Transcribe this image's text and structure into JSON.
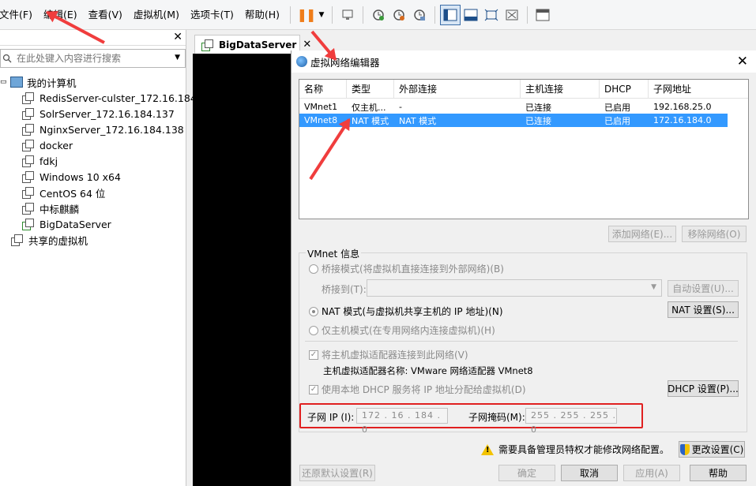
{
  "menu": {
    "items": [
      "文件(F)",
      "编辑(E)",
      "查看(V)",
      "虚拟机(M)",
      "选项卡(T)",
      "帮助(H)"
    ]
  },
  "toolbar": {
    "icons": [
      "pause-icon",
      "dropdown-icon",
      "send-ctrl-alt-del-icon",
      "snapshot-icon",
      "revert-snapshot-icon",
      "snapshot-manager-icon",
      "library-view-icon",
      "console-view-icon",
      "fullscreen-icon",
      "unity-icon",
      "thumbnail-icon"
    ]
  },
  "library": {
    "search_placeholder": "在此处键入内容进行搜索",
    "root_label": "我的计算机",
    "vms": [
      "RedisServer-culster_172.16.184.",
      "SolrServer_172.16.184.137",
      "NginxServer_172.16.184.138",
      "docker",
      "fdkj",
      "Windows 10 x64",
      "CentOS 64 位",
      "中标麒麟",
      "BigDataServer"
    ],
    "shared_label": "共享的虚拟机"
  },
  "vm_tab": {
    "label": "BigDataServer"
  },
  "dialog": {
    "title": "虚拟网络编辑器",
    "table": {
      "headers": [
        "名称",
        "类型",
        "外部连接",
        "主机连接",
        "DHCP",
        "子网地址"
      ],
      "rows": [
        [
          "VMnet1",
          "仅主机...",
          "-",
          "已连接",
          "已启用",
          "192.168.25.0"
        ],
        [
          "VMnet8",
          "NAT 模式",
          "NAT 模式",
          "已连接",
          "已启用",
          "172.16.184.0"
        ]
      ],
      "selected_row": 1
    },
    "add_network": "添加网络(E)...",
    "remove_network": "移除网络(O)",
    "vmnet_info": "VMnet 信息",
    "bridge_mode": "桥接模式(将虚拟机直接连接到外部网络)(B)",
    "bridge_to": "桥接到(T):",
    "auto_settings": "自动设置(U)...",
    "nat_mode": "NAT 模式(与虚拟机共享主机的 IP 地址)(N)",
    "nat_settings": "NAT 设置(S)...",
    "host_only": "仅主机模式(在专用网络内连接虚拟机)(H)",
    "connect_adapter": "将主机虚拟适配器连接到此网络(V)",
    "adapter_name": "主机虚拟适配器名称: VMware 网络适配器 VMnet8",
    "use_dhcp": "使用本地 DHCP 服务将 IP 地址分配给虚拟机(D)",
    "dhcp_settings": "DHCP 设置(P)...",
    "subnet_ip_label": "子网 IP (I):",
    "subnet_ip": "172 . 16 . 184 . 0",
    "subnet_mask_label": "子网掩码(M):",
    "subnet_mask": "255 . 255 . 255 . 0",
    "admin_warning": "需要具备管理员特权才能修改网络配置。",
    "change_settings": "更改设置(C)",
    "restore_defaults": "还原默认设置(R)",
    "ok": "确定",
    "cancel": "取消",
    "apply": "应用(A)",
    "help": "帮助"
  },
  "colors": {
    "selection": "#3399ff",
    "annotation": "#f03d3d",
    "pause": "#ef7d1a"
  }
}
